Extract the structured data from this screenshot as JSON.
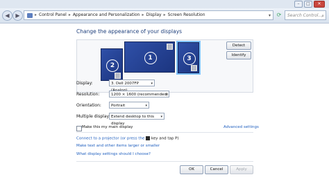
{
  "window": {
    "minimize": "–",
    "maximize": "□",
    "close": "✕"
  },
  "nav": {
    "back_icon": "back-arrow-icon",
    "forward_icon": "forward-arrow-icon",
    "breadcrumb": [
      "Control Panel",
      "Appearance and Personalization",
      "Display",
      "Screen Resolution"
    ],
    "search_placeholder": "Search Control..."
  },
  "page": {
    "heading": "Change the appearance of your displays",
    "detect_label": "Detect",
    "identify_label": "Identify",
    "monitors": [
      {
        "number": "2"
      },
      {
        "number": "1"
      },
      {
        "number": "3"
      }
    ]
  },
  "settings": {
    "display": {
      "label": "Display:",
      "value": "3. Dell 2007FP (Analog)"
    },
    "resolution": {
      "label": "Resolution:",
      "value": "1200 × 1600 (recommended)"
    },
    "orientation": {
      "label": "Orientation:",
      "value": "Portrait"
    },
    "multiple": {
      "label": "Multiple displays:",
      "value": "Extend desktop to this display"
    }
  },
  "main_display_label": "Make this my main display",
  "advanced_link": "Advanced settings",
  "projector_text": {
    "before": "Connect to a projector (or press the",
    "after": "key and tap P)"
  },
  "text_size_link": "Make text and other items larger or smaller",
  "help_link": "What display settings should I choose?",
  "buttons": {
    "ok": "OK",
    "cancel": "Cancel",
    "apply": "Apply"
  }
}
